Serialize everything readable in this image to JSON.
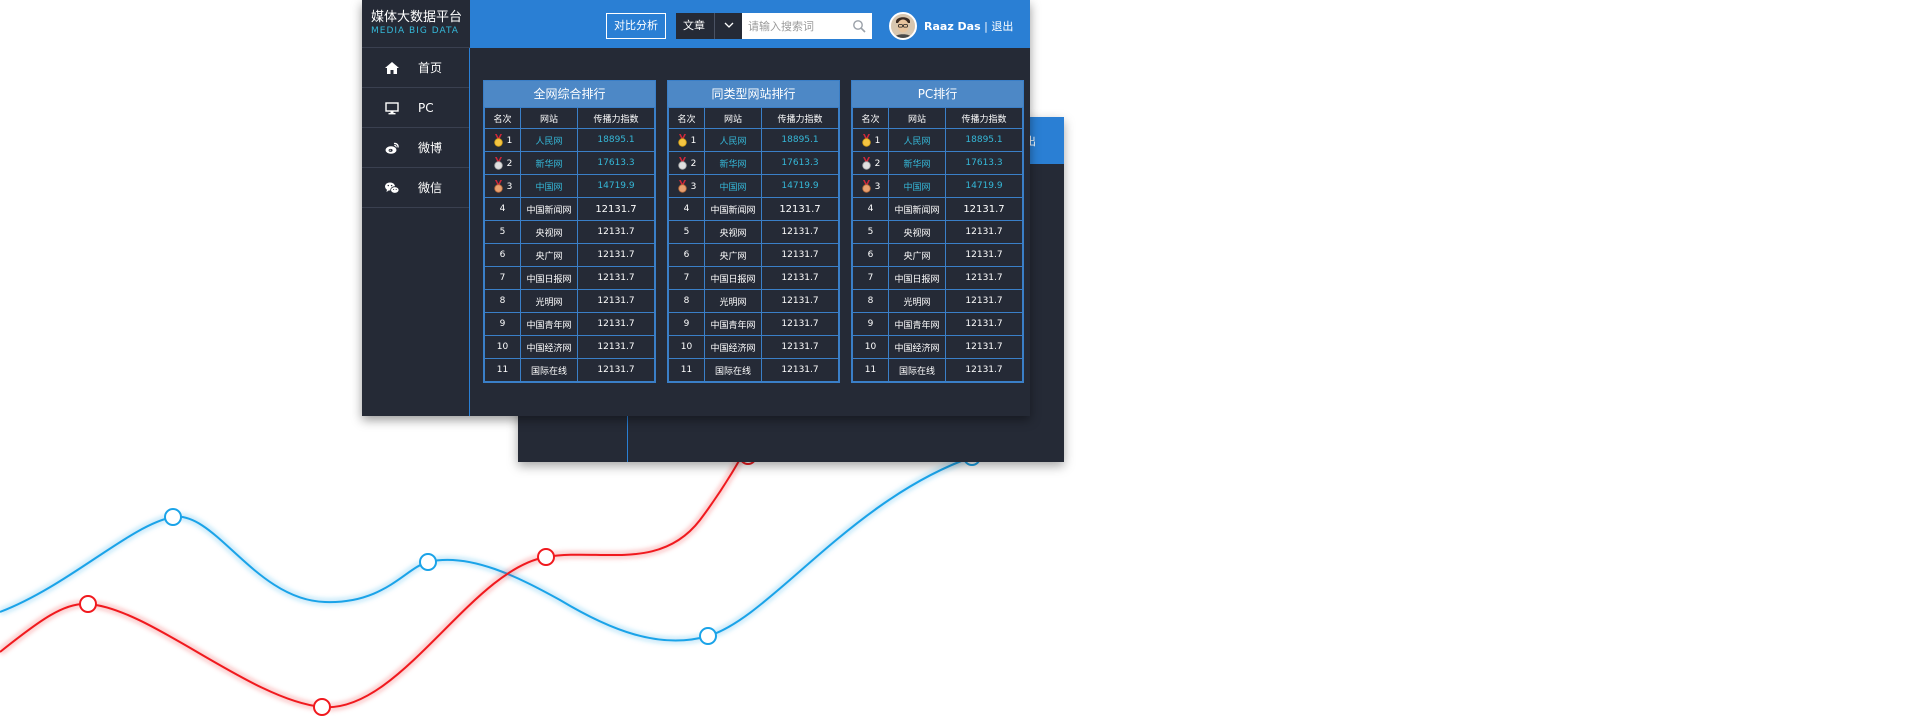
{
  "app": {
    "title_cn": "媒体大数据平台",
    "title_en": "MEDIA BIG DATA"
  },
  "header": {
    "compare_label": "对比分析",
    "search_type": "文章",
    "search_placeholder": "请输入搜索词",
    "user_name": "Raaz Das",
    "logout_label": "| 退出"
  },
  "back_window": {
    "header_text": "出"
  },
  "sidebar": {
    "items": [
      {
        "label": "首页",
        "icon": "home-icon"
      },
      {
        "label": "PC",
        "icon": "monitor-icon"
      },
      {
        "label": "微博",
        "icon": "weibo-icon"
      },
      {
        "label": "微信",
        "icon": "wechat-icon"
      }
    ]
  },
  "colors": {
    "accent": "#2a7fd4",
    "panel_bg": "#252a36",
    "highlight_text": "#35b8d8",
    "curve_blue": "#1aa3e8",
    "curve_red": "#f0191e"
  },
  "ranking": {
    "columns": [
      "名次",
      "网站",
      "传播力指数"
    ],
    "panels": [
      {
        "title": "全网综合排行",
        "rows": [
          {
            "rank": "1",
            "site": "人民网",
            "value": "18895.1",
            "medal": "gold"
          },
          {
            "rank": "2",
            "site": "新华网",
            "value": "17613.3",
            "medal": "silver"
          },
          {
            "rank": "3",
            "site": "中国网",
            "value": "14719.9",
            "medal": "bronze"
          },
          {
            "rank": "4",
            "site": "中国新闻网",
            "value": "12131.7"
          },
          {
            "rank": "5",
            "site": "央视网",
            "value": "12131.7"
          },
          {
            "rank": "6",
            "site": "央广网",
            "value": "12131.7"
          },
          {
            "rank": "7",
            "site": "中国日报网",
            "value": "12131.7"
          },
          {
            "rank": "8",
            "site": "光明网",
            "value": "12131.7"
          },
          {
            "rank": "9",
            "site": "中国青年网",
            "value": "12131.7"
          },
          {
            "rank": "10",
            "site": "中国经济网",
            "value": "12131.7"
          },
          {
            "rank": "11",
            "site": "国际在线",
            "value": "12131.7"
          }
        ]
      },
      {
        "title": "同类型网站排行",
        "rows": [
          {
            "rank": "1",
            "site": "人民网",
            "value": "18895.1",
            "medal": "gold"
          },
          {
            "rank": "2",
            "site": "新华网",
            "value": "17613.3",
            "medal": "silver"
          },
          {
            "rank": "3",
            "site": "中国网",
            "value": "14719.9",
            "medal": "bronze"
          },
          {
            "rank": "4",
            "site": "中国新闻网",
            "value": "12131.7"
          },
          {
            "rank": "5",
            "site": "央视网",
            "value": "12131.7"
          },
          {
            "rank": "6",
            "site": "央广网",
            "value": "12131.7"
          },
          {
            "rank": "7",
            "site": "中国日报网",
            "value": "12131.7"
          },
          {
            "rank": "8",
            "site": "光明网",
            "value": "12131.7"
          },
          {
            "rank": "9",
            "site": "中国青年网",
            "value": "12131.7"
          },
          {
            "rank": "10",
            "site": "中国经济网",
            "value": "12131.7"
          },
          {
            "rank": "11",
            "site": "国际在线",
            "value": "12131.7"
          }
        ]
      },
      {
        "title": "PC排行",
        "rows": [
          {
            "rank": "1",
            "site": "人民网",
            "value": "18895.1",
            "medal": "gold"
          },
          {
            "rank": "2",
            "site": "新华网",
            "value": "17613.3",
            "medal": "silver"
          },
          {
            "rank": "3",
            "site": "中国网",
            "value": "14719.9",
            "medal": "bronze"
          },
          {
            "rank": "4",
            "site": "中国新闻网",
            "value": "12131.7"
          },
          {
            "rank": "5",
            "site": "央视网",
            "value": "12131.7"
          },
          {
            "rank": "6",
            "site": "央广网",
            "value": "12131.7"
          },
          {
            "rank": "7",
            "site": "中国日报网",
            "value": "12131.7"
          },
          {
            "rank": "8",
            "site": "光明网",
            "value": "12131.7"
          },
          {
            "rank": "9",
            "site": "中国青年网",
            "value": "12131.7"
          },
          {
            "rank": "10",
            "site": "中国经济网",
            "value": "12131.7"
          },
          {
            "rank": "11",
            "site": "国际在线",
            "value": "12131.7"
          }
        ]
      }
    ]
  }
}
